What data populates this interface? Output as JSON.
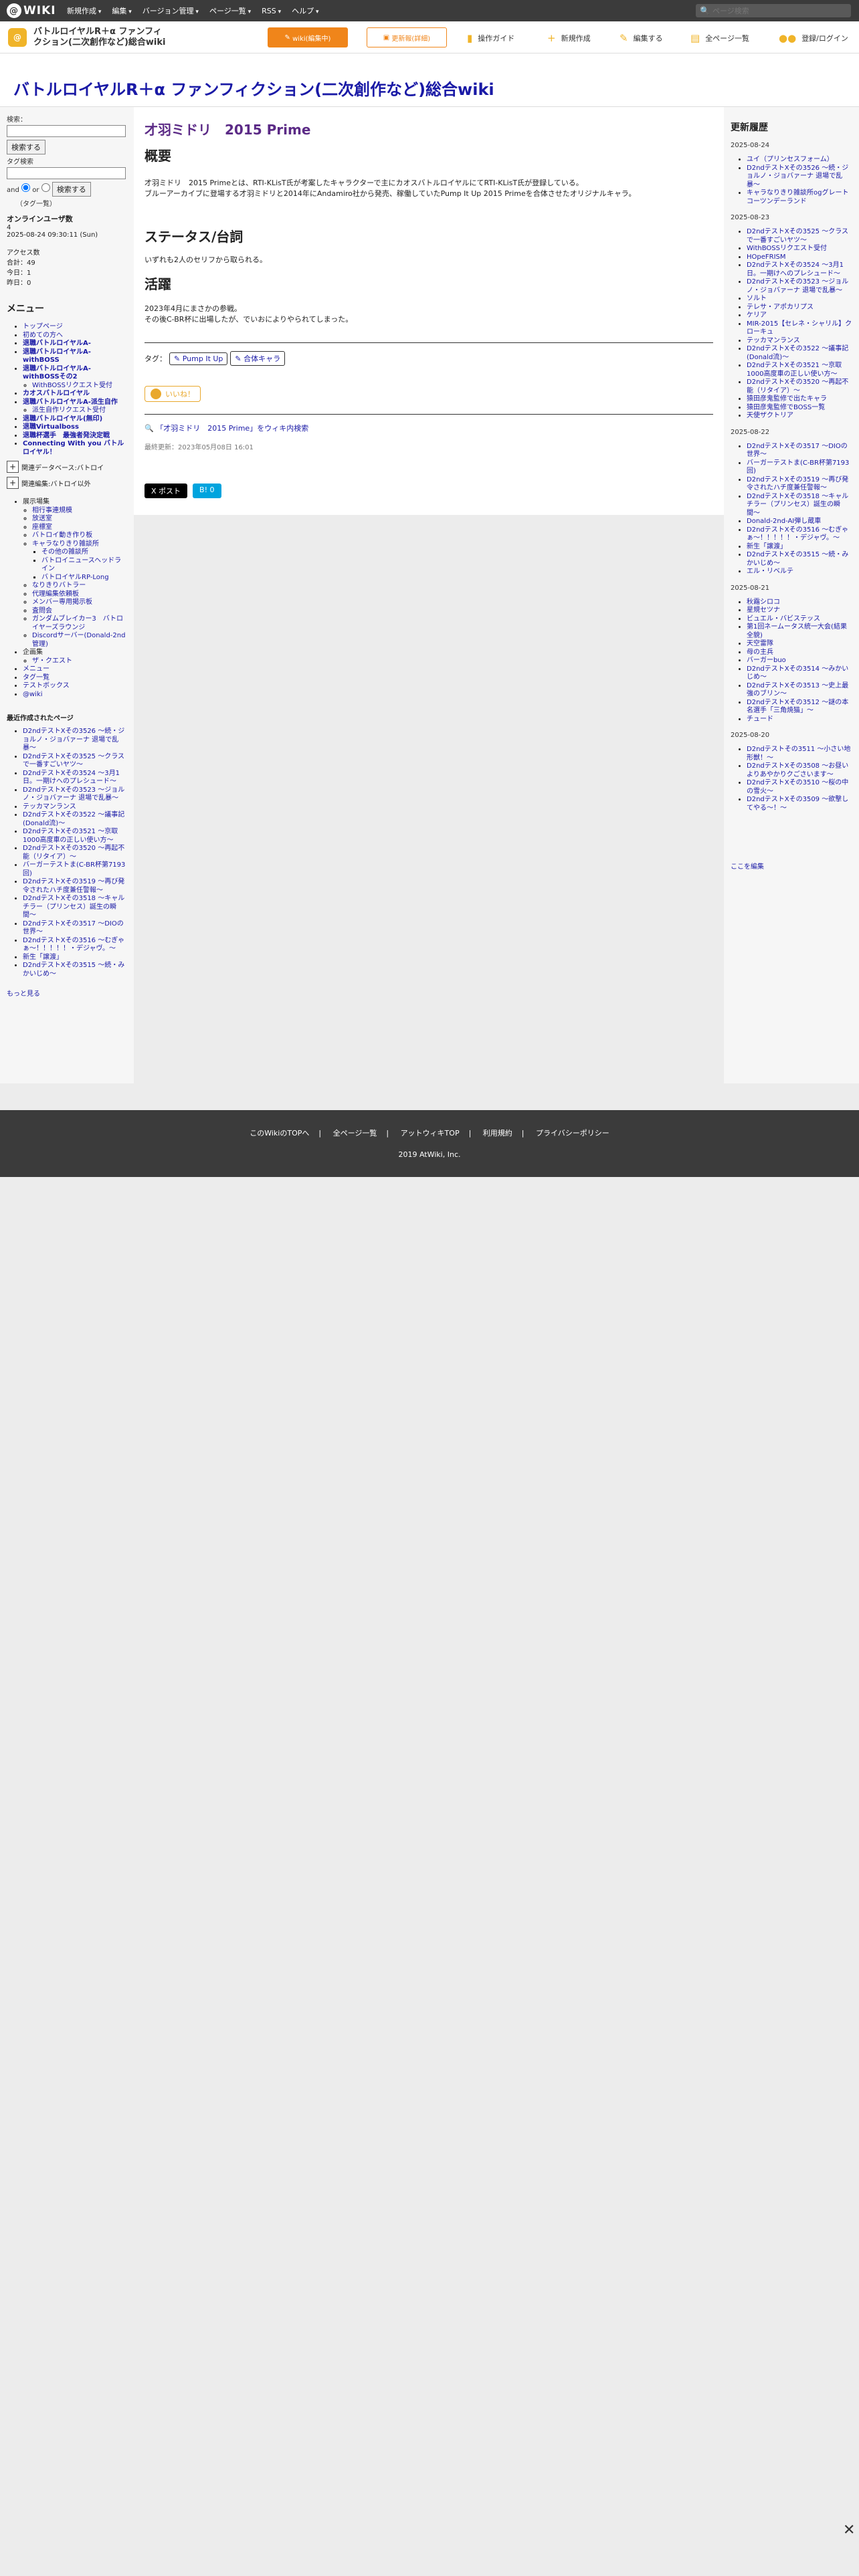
{
  "topbar": {
    "logo": "WIKI",
    "menus": [
      "新規作成",
      "編集",
      "バージョン管理",
      "ページ一覧",
      "RSS",
      "ヘルプ"
    ],
    "search_placeholder": "ページ検索"
  },
  "header": {
    "site_title": "バトルロイヤルR＋α ファンフィクション(二次創作など)総合wiki",
    "edit_button": "wiki(編集中)",
    "info_button": "更新報(詳細)",
    "tools": [
      "操作ガイド",
      "新規作成",
      "編集する",
      "全ページ一覧",
      "登録/ログイン"
    ]
  },
  "page_heading": "バトルロイヤルR＋α ファンフィクション(二次創作など)総合wiki",
  "left": {
    "search_label": "検索：",
    "search_button": "検索する",
    "tag_search_label": "タグ検索",
    "and_label": "and",
    "or_label": "or",
    "tag_hint": "（タグ一覧）",
    "online_label": "オンラインユーザ数",
    "online_count": "4",
    "datetime": "2025-08-24 09:30:11 (Sun)",
    "access_label": "アクセス数",
    "total": "合計：49",
    "today": "今日：1",
    "yesterday": "昨日：0",
    "menu_title": "メニュー",
    "menu_items": [
      {
        "label": "トップページ",
        "bold": false
      },
      {
        "label": "初めての方へ",
        "bold": false
      },
      {
        "label": "退職バトルロイヤルA-",
        "bold": true
      },
      {
        "label": "退職バトルロイヤルA-withBOSS",
        "bold": true
      },
      {
        "label": "退職バトルロイヤルA-withBOSSその2",
        "bold": true
      }
    ],
    "menu_sub1": [
      "WithBOSSリクエスト受付"
    ],
    "menu_items2": [
      {
        "label": "カオスバトルロイヤル",
        "bold": true
      },
      {
        "label": "退職バトルロイヤルA-派生自作",
        "bold": true
      }
    ],
    "menu_sub2": [
      "派生自作リクエスト受付"
    ],
    "menu_items3": [
      {
        "label": "退職バトルロイヤル(無印)",
        "bold": true
      },
      {
        "label": "退職Virtualboss",
        "bold": true
      },
      {
        "label": "退職杯選手　最強者発決定戦",
        "bold": true
      },
      {
        "label": "Connecting With you バトルロイヤル！",
        "bold": true
      }
    ],
    "toggle1": "関連データベース:バトロイ",
    "toggle2": "関連編集:バトロイ以外",
    "exhibit_title": "展示場集",
    "exhibit_items": [
      "相行事連規模",
      "放送室",
      "座標室",
      "バトロイ動き作り板",
      "キャラなりきり雑談所"
    ],
    "exhibit_sub": [
      "その他の雑談所",
      "バトロイニュースヘッドライン",
      "バトロイヤルRP-Long"
    ],
    "exhibit_items2": [
      "なりきりバトラー",
      "代理編集依頼板",
      "メンバー専用掲示板",
      "査問会",
      "ガンダムブレイカー3　バトロイヤーズラウンジ",
      "Discordサーバー(Donald-2nd管理)"
    ],
    "project_title": "企画集",
    "project_items": [
      "ザ・クエスト"
    ],
    "misc_items": [
      "メニュー",
      "タグ一覧",
      "テストボックス",
      "@wiki"
    ],
    "recent_title": "最近作成されたページ",
    "recent_items": [
      "D2ndテストXその3526 〜続・ジョルノ・ジョバァーナ 退場で乱暴〜",
      "D2ndテストXその3525 〜クラスで一番すごいヤツ〜",
      "D2ndテストXその3524 〜3月1日。一期けへのプレシュード〜",
      "D2ndテストXその3523 〜ジョルノ・ジョバァーナ 退場で乱暴〜",
      "テッカマンランス",
      "D2ndテストXその3522 〜議事記(Donald流)〜",
      "D2ndテストXその3521 〜京取1000高度車の正しい使い方〜",
      "D2ndテストXその3520 〜再起不能（リタイア）〜",
      "バーガーテストま(C-BR杯第7193回)",
      "D2ndテストXその3519 〜再び発令されたハチ度兼任警報〜",
      "D2ndテストXその3518 〜キャルチラー（プリンセス）誕生の瞬間〜",
      "D2ndテストXその3517 〜DIOの世界〜",
      "D2ndテストXその3516 〜むぎゃぁ〜！！！！！・デジャヴ。〜",
      "新生「譲渡」",
      "D2ndテストXその3515 〜続・みかいじめ〜"
    ],
    "more": "もっと見る"
  },
  "main": {
    "page_title": "才羽ミドリ　2015 Prime",
    "overview_heading": "概要",
    "overview_text1": "才羽ミドリ　2015 Primeとは、RTI-KLisT氏が考案したキャラクターで主にカオスバトルロイヤルにてRTI-KLisT氏が登録している。",
    "overview_text2": "ブルーアーカイブに登場する才羽ミドリと2014年にAndamiro社から発売、稼働していたPump It Up 2015 Primeを合体させたオリジナルキャラ。",
    "status_heading": "ステータス/台詞",
    "status_text": "いずれも2人のセリフから取られる。",
    "activity_heading": "活躍",
    "activity_text1": "2023年4月にまさかの参戦。",
    "activity_text2": "その後C-BR杯に出場したが、でいおによりやられてしまった。",
    "tags_label": "タグ：",
    "tags": [
      "Pump It Up",
      "合体キャラ"
    ],
    "like_label": "いいね！",
    "search_link": "「才羽ミドリ　2015 Prime」をウィキ内検索",
    "last_updated": "最終更新：2023年05月08日 16:01",
    "share_x": "X ポスト",
    "share_hatena": "B! 0"
  },
  "right": {
    "title": "更新履歴",
    "groups": [
      {
        "date": "2025-08-24",
        "items": [
          "ユイ（プリンセスフォーム）",
          "D2ndテストXその3526 〜続・ジョルノ・ジョバァーナ 退場で乱暴〜",
          "キャラなりきり雑談所ogグレートコーツンデーランド"
        ]
      },
      {
        "date": "2025-08-23",
        "items": [
          "D2ndテストXその3525 〜クラスで一番すごいヤツ〜",
          "WithBOSSリクエスト受付",
          "HOpeFRISM",
          "D2ndテストXその3524 〜3月1日。一期けへのプレシュード〜",
          "D2ndテストXその3523 〜ジョルノ・ジョバァーナ 退場で乱暴〜",
          "ソルト",
          "テレサ・アポカリプス",
          "ケリア",
          "MIR-2015【セレネ・シャリル】クローキュ",
          "テッカマンランス",
          "D2ndテストXその3522 〜議事記(Donald流)〜",
          "D2ndテストXその3521 〜京取1000高度車の正しい使い方〜",
          "D2ndテストXその3520 〜再起不能（リタイア）〜",
          "猿田彦鬼監修で出たキャラ",
          "猿田彦鬼監修でBOSS一覧",
          "天使ザクトリア"
        ]
      },
      {
        "date": "2025-08-22",
        "items": [
          "D2ndテストXその3517 〜DIOの世界〜",
          "バーガーテストま(C-BR杯第7193回)",
          "D2ndテストXその3519 〜再び発令されたハチ度兼任警報〜",
          "D2ndテストXその3518 〜キャルチラー（プリンセス）誕生の瞬間〜",
          "Donald-2nd-AI弾し蔵車",
          "D2ndテストXその3516 〜むぎゃぁ〜！！！！！・デジャヴ。〜",
          "新生「譲渡」",
          "D2ndテストXその3515 〜続・みかいじめ〜",
          "エル・リベルテ"
        ]
      },
      {
        "date": "2025-08-21",
        "items": [
          "秋霜シロコ",
          "星規セツナ",
          "ビュエル・バビステッス",
          "第1回ネームータス統一大会(結果全貌)",
          "天空雷隊",
          "母の主兵",
          "バーガーbuo",
          "D2ndテストXその3514 〜みかいじめ〜",
          "D2ndテストXその3513 〜史上最強のブリン〜",
          "D2ndテストXその3512 〜謎の本名選手「三角焼猫」〜",
          "チュード"
        ]
      },
      {
        "date": "2025-08-20",
        "items": [
          "D2ndテストその3511 〜小さい地形獣！〜",
          "D2ndテストXその3508 〜お昼いよりあやかりクごさいます〜",
          "D2ndテストXその3510 〜桜の中の雪火〜",
          "D2ndテストXその3509 〜欲撃してやる〜！〜"
        ]
      }
    ],
    "edit_here": "ここを編集"
  },
  "footer": {
    "links": [
      "このWikiのTOPへ",
      "全ページ一覧",
      "アットウィキTOP",
      "利用規約",
      "プライバシーポリシー"
    ],
    "copyright": "2019 AtWiki, Inc."
  },
  "close_label": "✕"
}
